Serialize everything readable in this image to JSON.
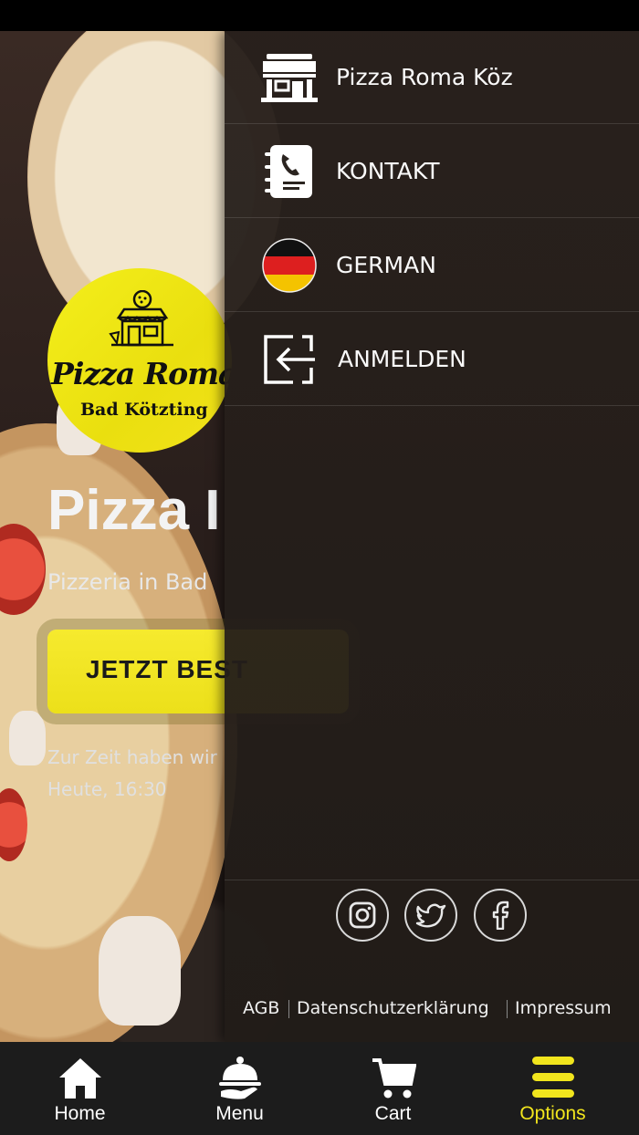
{
  "colors": {
    "accent": "#f1e51d",
    "drawer_bg": "#2b2420",
    "tabbar_bg": "#1c1c1c"
  },
  "home": {
    "logo_title": "Pizza Roma",
    "logo_subtitle": "Bad Kötzting",
    "hero_title": "Pizza I",
    "hero_subtitle": "Pizzeria in Bad",
    "cta_label": "JETZT BEST",
    "status_text": "Zur Zeit haben wir",
    "status_time": "Heute, 16:30"
  },
  "drawer": {
    "items": [
      {
        "label": "Pizza Roma Köz",
        "icon": "store-icon"
      },
      {
        "label": "KONTAKT",
        "icon": "contact-book-icon"
      },
      {
        "label": "GERMAN",
        "icon": "germany-flag-icon"
      },
      {
        "label": "ANMELDEN",
        "icon": "login-icon"
      }
    ],
    "social": [
      "instagram-icon",
      "twitter-icon",
      "facebook-icon"
    ],
    "legal": [
      "AGB",
      "Datenschutzerklärung",
      "Impressum"
    ]
  },
  "tabbar": {
    "tabs": [
      {
        "label": "Home",
        "icon": "home-icon"
      },
      {
        "label": "Menu",
        "icon": "cloche-icon"
      },
      {
        "label": "Cart",
        "icon": "cart-icon"
      },
      {
        "label": "Options",
        "icon": "options-icon",
        "active": true
      }
    ]
  }
}
